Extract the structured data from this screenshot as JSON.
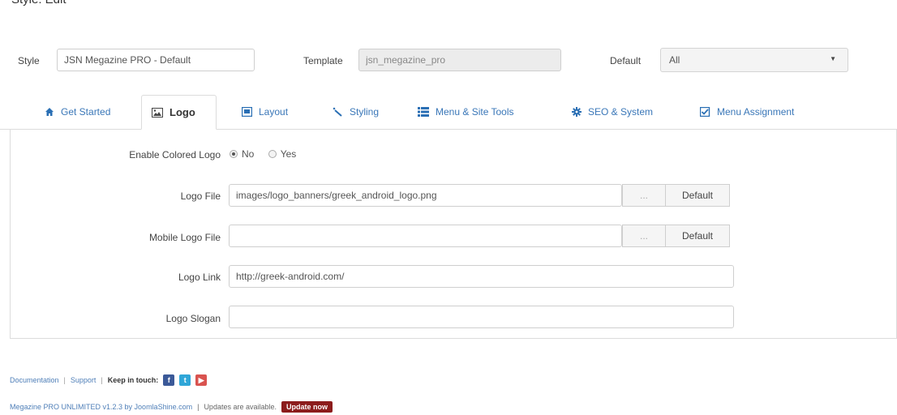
{
  "header": {
    "cut_title": "Style: Edit"
  },
  "style_row": {
    "style_label": "Style",
    "style_value": "JSN Megazine PRO - Default",
    "template_label": "Template",
    "template_value": "jsn_megazine_pro",
    "default_label": "Default",
    "default_value": "All"
  },
  "tabs": [
    {
      "label": "Get Started",
      "icon": "home-icon",
      "active": false
    },
    {
      "label": "Logo",
      "icon": "image-icon",
      "active": true
    },
    {
      "label": "Layout",
      "icon": "layout-icon",
      "active": false
    },
    {
      "label": "Styling",
      "icon": "magic-wand-icon",
      "active": false
    },
    {
      "label": "Menu & Site Tools",
      "icon": "list-icon",
      "active": false
    },
    {
      "label": "SEO & System",
      "icon": "gear-icon",
      "active": false
    },
    {
      "label": "Menu Assignment",
      "icon": "checkbox-icon",
      "active": false
    }
  ],
  "logo_form": {
    "enable_colored_logo": {
      "label": "Enable Colored Logo",
      "options": [
        "No",
        "Yes"
      ],
      "selected": "No"
    },
    "logo_file": {
      "label": "Logo File",
      "value": "images/logo_banners/greek_android_logo.png",
      "browse": "...",
      "default_button": "Default"
    },
    "mobile_logo_file": {
      "label": "Mobile Logo File",
      "value": "",
      "browse": "...",
      "default_button": "Default"
    },
    "logo_link": {
      "label": "Logo Link",
      "value": "http://greek-android.com/"
    },
    "logo_slogan": {
      "label": "Logo Slogan",
      "value": ""
    }
  },
  "footer": {
    "documentation": "Documentation",
    "support": "Support",
    "keep_in_touch": "Keep in touch:",
    "social": [
      {
        "icon": "facebook-icon",
        "glyph": "f",
        "color": "#3b5998"
      },
      {
        "icon": "twitter-icon",
        "glyph": "t",
        "color": "#2fa6d8"
      },
      {
        "icon": "youtube-icon",
        "glyph": "▶",
        "color": "#d9534f"
      }
    ],
    "version": "Megazine PRO UNLIMITED v1.2.3 by JoomlaShine.com",
    "updates_text": "Updates are available.",
    "update_button": "Update now"
  },
  "colors": {
    "tab_link": "#3a77b8",
    "update_button": "#8c1c1c"
  }
}
